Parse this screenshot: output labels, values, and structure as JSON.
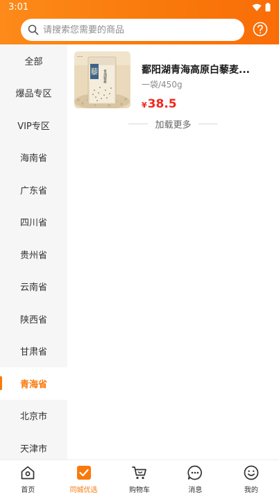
{
  "status": {
    "time": "3:01"
  },
  "search": {
    "placeholder": "请搜索您需要的商品"
  },
  "colors": {
    "brand": "#f97a0c",
    "price": "#f0281e",
    "sidebar_bg": "#f6f6f6"
  },
  "sidebar": {
    "items": [
      {
        "label": "全部"
      },
      {
        "label": "爆品专区"
      },
      {
        "label": "VIP专区"
      },
      {
        "label": "海南省"
      },
      {
        "label": "广东省"
      },
      {
        "label": "四川省"
      },
      {
        "label": "贵州省"
      },
      {
        "label": "云南省"
      },
      {
        "label": "陕西省"
      },
      {
        "label": "甘肃省"
      },
      {
        "label": "青海省"
      },
      {
        "label": "北京市"
      },
      {
        "label": "天津市"
      }
    ],
    "active_index": 10
  },
  "product": {
    "name": "鄱阳湖青海高原白藜麦...",
    "spec": "一袋/450g",
    "currency": "¥",
    "price": "38.5",
    "thumb_icon": "quinoa-package-image",
    "thumb_text": "青海藜麦",
    "thumb_big_char": "藜"
  },
  "load_more": "加载更多",
  "tabbar": {
    "tabs": [
      {
        "label": "首页",
        "icon": "home-icon"
      },
      {
        "label": "同城优选",
        "icon": "check-square-icon"
      },
      {
        "label": "购物车",
        "icon": "cart-icon"
      },
      {
        "label": "消息",
        "icon": "message-icon"
      },
      {
        "label": "我的",
        "icon": "smile-icon"
      }
    ],
    "active_index": 1
  }
}
